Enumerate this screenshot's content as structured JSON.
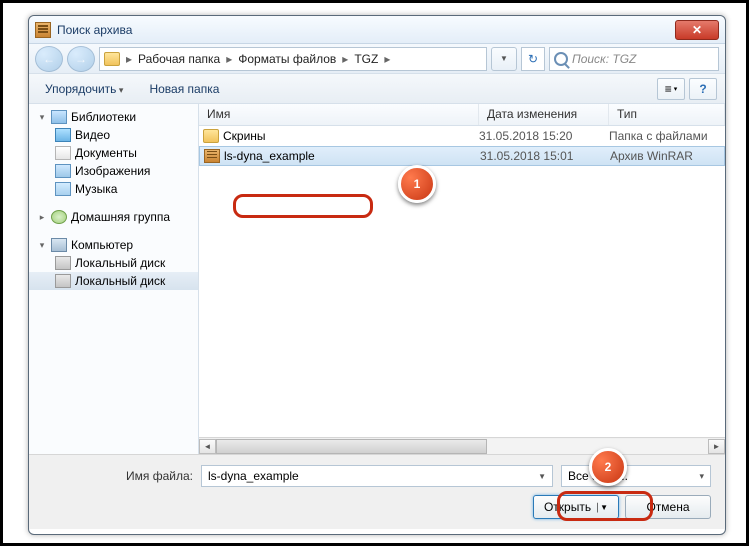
{
  "title": "Поиск архива",
  "close_glyph": "✕",
  "nav": {
    "back_glyph": "←",
    "fwd_glyph": "→",
    "crumbs": [
      "Рабочая папка",
      "Форматы файлов",
      "TGZ"
    ],
    "sep": "▸",
    "refresh_glyph": "↻",
    "search_placeholder": "Поиск: TGZ"
  },
  "toolbar": {
    "organize": "Упорядочить",
    "newfolder": "Новая папка",
    "icons": {
      "view_glyph": "≡",
      "help_glyph": "?"
    }
  },
  "tree": {
    "libraries": "Библиотеки",
    "video": "Видео",
    "documents": "Документы",
    "images": "Изображения",
    "music": "Музыка",
    "homegroup": "Домашняя группа",
    "computer": "Компьютер",
    "disk1": "Локальный диск",
    "disk2": "Локальный диск"
  },
  "columns": {
    "name": "Имя",
    "date": "Дата изменения",
    "type": "Тип"
  },
  "rows": [
    {
      "name": "Скрины",
      "date": "31.05.2018 15:20",
      "type": "Папка с файлами",
      "icon": "folder"
    },
    {
      "name": "ls-dyna_example",
      "date": "31.05.2018 15:01",
      "type": "Архив WinRAR",
      "icon": "arch"
    }
  ],
  "scroll": {
    "left": "◄",
    "right": "►"
  },
  "bottom": {
    "filename_label": "Имя файла:",
    "filename_value": "ls-dyna_example",
    "filter": "Все архи...",
    "open": "Открыть",
    "cancel": "Отмена",
    "drop_glyph": "▼"
  },
  "badges": {
    "one": "1",
    "two": "2"
  }
}
